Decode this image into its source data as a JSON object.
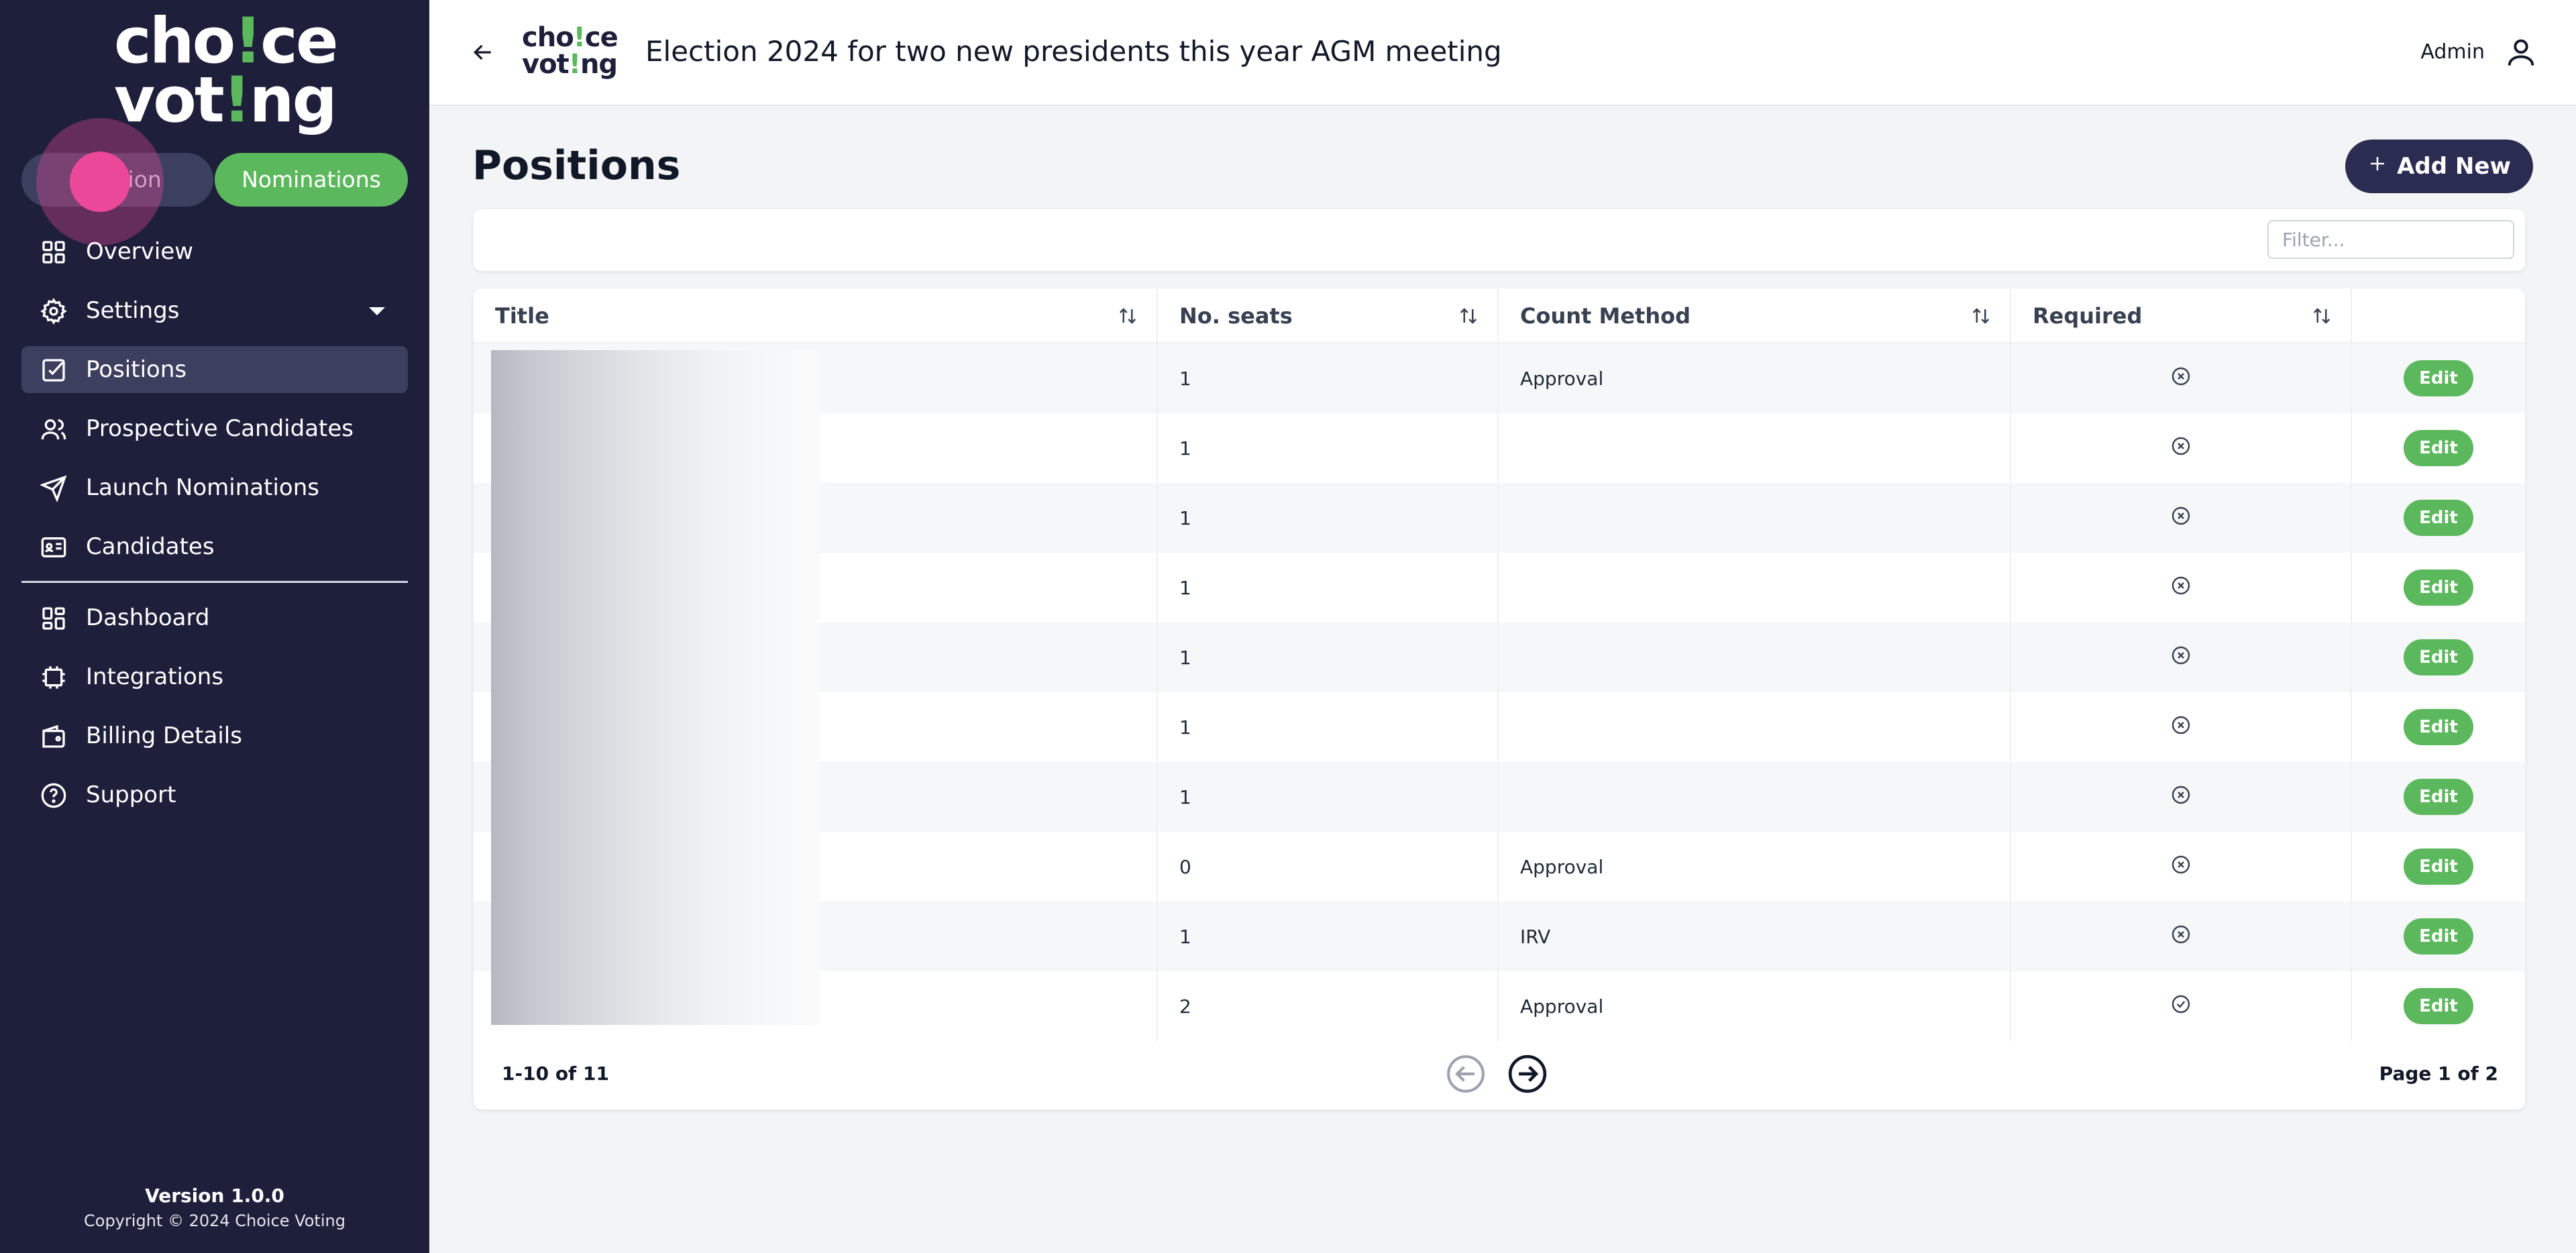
{
  "sidebar": {
    "logo_line1_a": "cho",
    "logo_line1_bang": "!",
    "logo_line1_b": "ce",
    "logo_line2_a": "vot",
    "logo_line2_bang": "!",
    "logo_line2_b": "ng",
    "toggle_left": "Election",
    "toggle_right": "Nominations",
    "items": [
      {
        "label": "Overview",
        "icon": "grid-icon"
      },
      {
        "label": "Settings",
        "icon": "gear-icon"
      },
      {
        "label": "Positions",
        "icon": "checkbox-icon"
      },
      {
        "label": "Prospective Candidates",
        "icon": "users-icon"
      },
      {
        "label": "Launch Nominations",
        "icon": "send-icon"
      },
      {
        "label": "Candidates",
        "icon": "id-card-icon"
      },
      {
        "label": "Dashboard",
        "icon": "dashboard-icon"
      },
      {
        "label": "Integrations",
        "icon": "chip-icon"
      },
      {
        "label": "Billing Details",
        "icon": "wallet-icon"
      },
      {
        "label": "Support",
        "icon": "help-icon"
      }
    ],
    "version": "Version 1.0.0",
    "copyright": "Copyright © 2024 Choice Voting"
  },
  "header": {
    "title": "Election 2024 for two new presidents this year AGM meeting",
    "user": "Admin"
  },
  "main": {
    "title": "Positions",
    "add_button": "Add New",
    "filter_placeholder": "Filter..."
  },
  "table": {
    "columns": [
      "Title",
      "No. seats",
      "Count Method",
      "Required",
      ""
    ],
    "rows": [
      {
        "seats": "1",
        "method": "Approval",
        "required": false
      },
      {
        "seats": "1",
        "method": "",
        "required": false
      },
      {
        "seats": "1",
        "method": "",
        "required": false
      },
      {
        "seats": "1",
        "method": "",
        "required": false
      },
      {
        "seats": "1",
        "method": "",
        "required": false
      },
      {
        "seats": "1",
        "method": "",
        "required": false
      },
      {
        "seats": "1",
        "method": "",
        "required": false
      },
      {
        "seats": "0",
        "method": "Approval",
        "required": false
      },
      {
        "seats": "1",
        "method": "IRV",
        "required": false
      },
      {
        "seats": "2",
        "method": "Approval",
        "required": true
      }
    ],
    "edit_label": "Edit",
    "range": "1-10 of 11",
    "page_info": "Page 1 of 2"
  },
  "colors": {
    "sidebar_bg": "#1e1f3b",
    "accent_green": "#5cb85c",
    "primary_button": "#2b2c52"
  }
}
